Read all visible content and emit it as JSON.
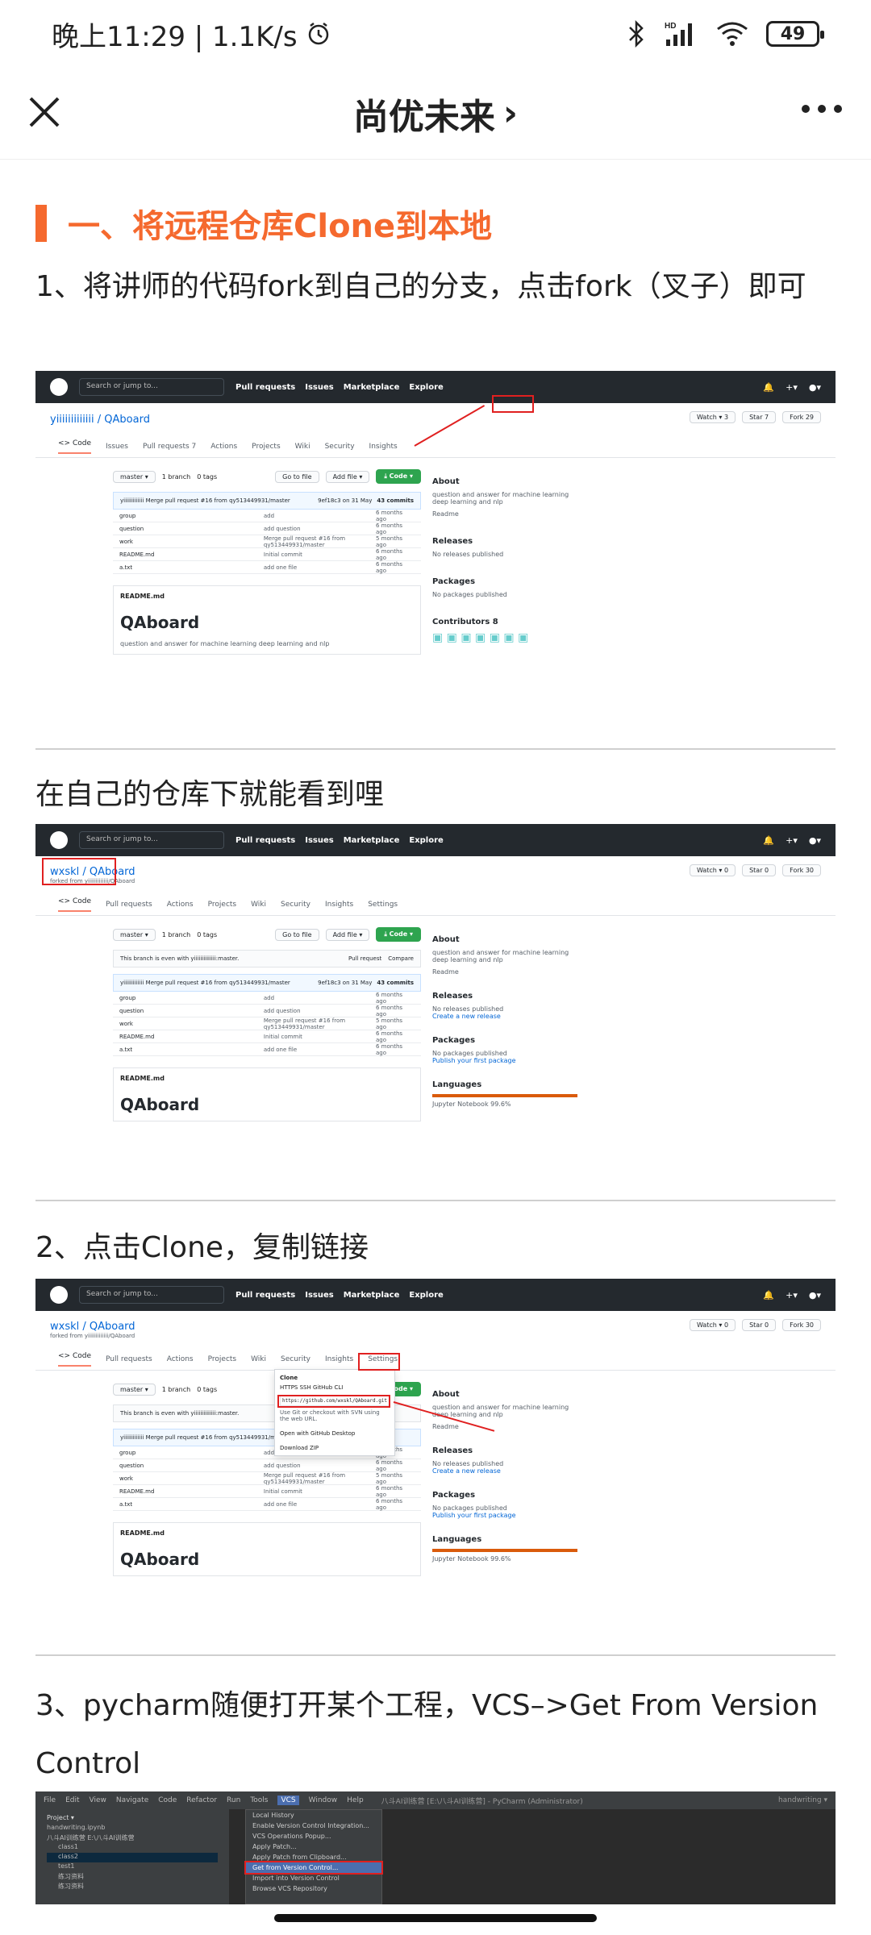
{
  "status_bar": {
    "time": "晚上11:29 | 1.1K/s",
    "battery": "49",
    "hd": "HD"
  },
  "nav": {
    "title": "尚优未来",
    "title_chevron": "›"
  },
  "article": {
    "section_title": "一、将远程仓库Clone到本地",
    "step1": "1、将讲师的代码fork到自己的分支，点击fork（叉子）即可",
    "after_fork": "在自己的仓库下就能看到哩",
    "step2": "2、点击Clone，复制链接",
    "step3": "3、pycharm随便打开某个工程，VCS–>Get From Version Control"
  },
  "github": {
    "search_placeholder": "Search or jump to...",
    "menu": [
      "Pull requests",
      "Issues",
      "Marketplace",
      "Explore"
    ],
    "repo1": "yiiiiiiiiiiiii / QAboard",
    "repo2": "wxskl / QAboard",
    "forked_from": "forked from yiiiiiiiiiiiii/QAboard",
    "watch": "Watch ▾",
    "star": "Star",
    "fork": "Fork",
    "fork_count1": "29",
    "fork_count2": "30",
    "watch_count": "3",
    "star_count": "7",
    "watch_count2": "0",
    "star_count2": "0",
    "tabs": [
      "<> Code",
      "Issues",
      "Pull requests 7",
      "Actions",
      "Projects",
      "Wiki",
      "Security",
      "Insights"
    ],
    "tabs2": [
      "<> Code",
      "Pull requests",
      "Actions",
      "Projects",
      "Wiki",
      "Security",
      "Insights",
      "Settings"
    ],
    "branch": "master ▾",
    "branch_count": "1 branch",
    "tags": "0 tags",
    "goto_file": "Go to file",
    "add_file": "Add file ▾",
    "code_btn": "⤓ Code ▾",
    "even_with": "This branch is even with yiiiiiiiiiiiiii:master.",
    "pull_request": "Pull request",
    "compare": "Compare",
    "commit_msg": "yiiiiiiiiiiiii Merge pull request #16 from qy513449931/master",
    "commit_hash": "9ef18c3 on 31 May",
    "commits": "43 commits",
    "files": [
      {
        "name": "group",
        "msg": "add",
        "time": "6 months ago"
      },
      {
        "name": "question",
        "msg": "add question",
        "time": "6 months ago"
      },
      {
        "name": "work",
        "msg": "Merge pull request #16 from qy513449931/master",
        "time": "5 months ago"
      },
      {
        "name": "README.md",
        "msg": "Initial commit",
        "time": "6 months ago"
      },
      {
        "name": "a.txt",
        "msg": "add one file",
        "time": "6 months ago"
      }
    ],
    "readme_label": "README.md",
    "readme_title": "QAboard",
    "readme_desc": "question and answer for machine learning deep learning and nlp",
    "about": "About",
    "about_desc": "question and answer for machine learning deep learning and nlp",
    "readme_link": "Readme",
    "releases": "Releases",
    "no_releases": "No releases published",
    "create_release": "Create a new release",
    "packages": "Packages",
    "no_packages": "No packages published",
    "publish_package": "Publish your first package",
    "contributors": "Contributors 8",
    "languages": "Languages",
    "lang_item": "Jupyter Notebook 99.6%",
    "clone_title": "Clone",
    "clone_tabs": "HTTPS   SSH   GitHub CLI",
    "clone_url": "https://github.com/wxskl/QAboard.git",
    "clone_hint": "Use Git or checkout with SVN using the web URL.",
    "open_desktop": "Open with GitHub Desktop",
    "download_zip": "Download ZIP"
  },
  "pycharm": {
    "menu": [
      "File",
      "Edit",
      "View",
      "Navigate",
      "Code",
      "Refactor",
      "Run",
      "Tools",
      "VCS",
      "Window",
      "Help"
    ],
    "window_title": "八斗AI训练营 [E:\\八斗AI训练营] - PyCharm (Administrator)",
    "project_label": "Project ▾",
    "tree": [
      "handwriting.ipynb",
      "八斗AI训练营 E:\\八斗AI训练营",
      "class1",
      "class2",
      "test1",
      "练习资料",
      "练习资料"
    ],
    "dropdown": [
      "Local History",
      "Enable Version Control Integration...",
      "VCS Operations Popup...",
      "Apply Patch...",
      "Apply Patch from Clipboard...",
      "Get from Version Control...",
      "Import into Version Control",
      "Browse VCS Repository"
    ],
    "run_config": "handwriting ▾"
  }
}
